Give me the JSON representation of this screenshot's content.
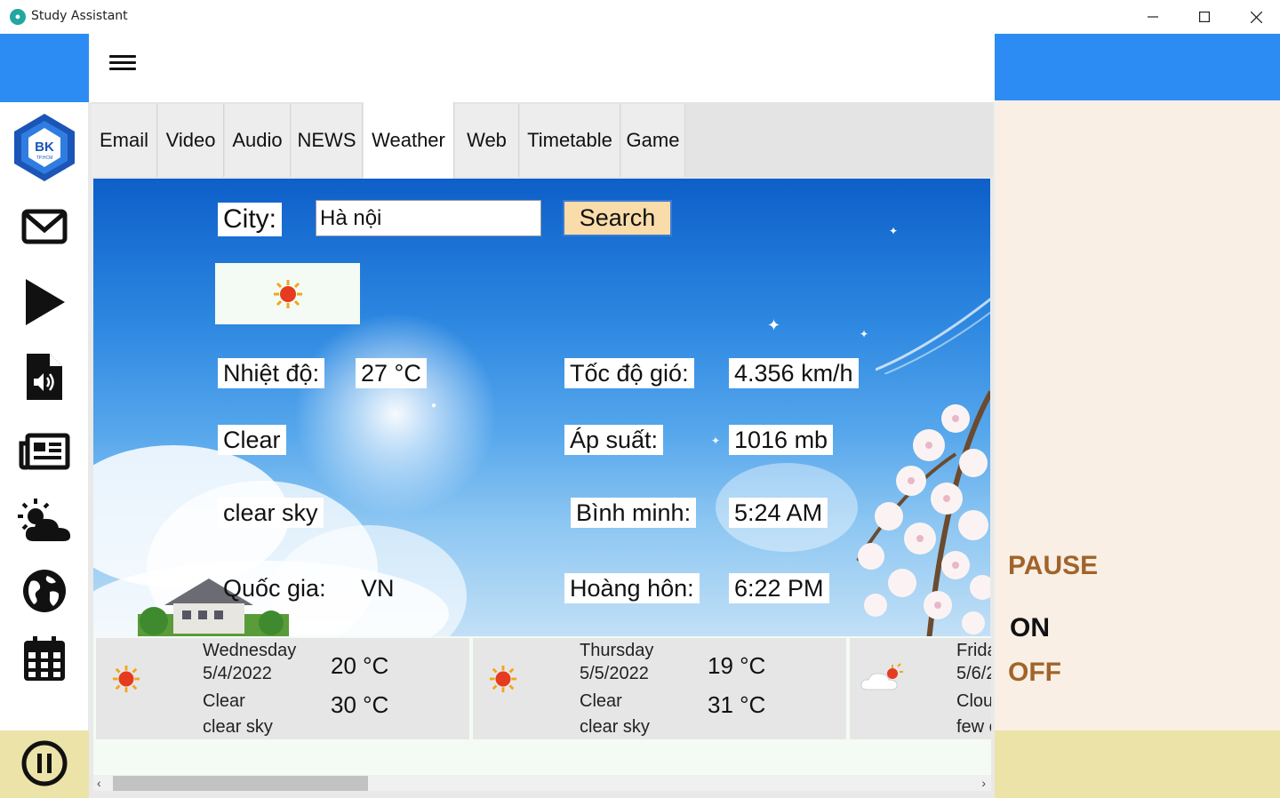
{
  "window": {
    "title": "Study Assistant",
    "minimize_icon": "minimize-icon",
    "maximize_icon": "maximize-icon",
    "close_icon": "close-icon"
  },
  "header": {
    "menu_icon": "hamburger-icon",
    "accent_color": "#2d8cf4"
  },
  "sidebar": {
    "logo": {
      "text": "BK",
      "subtext": "TP.HCM"
    },
    "items": [
      {
        "icon": "mail-icon"
      },
      {
        "icon": "play-icon"
      },
      {
        "icon": "audio-file-icon"
      },
      {
        "icon": "newspaper-icon"
      },
      {
        "icon": "weather-icon"
      },
      {
        "icon": "globe-icon"
      },
      {
        "icon": "calendar-icon"
      }
    ],
    "pause_icon": "pause-circle-icon"
  },
  "tabs": [
    {
      "label": "Email",
      "active": false
    },
    {
      "label": "Video",
      "active": false
    },
    {
      "label": "Audio",
      "active": false
    },
    {
      "label": "NEWS",
      "active": false
    },
    {
      "label": "Weather",
      "active": true
    },
    {
      "label": "Web",
      "active": false
    },
    {
      "label": "Timetable",
      "active": false
    },
    {
      "label": "Game",
      "active": false
    }
  ],
  "weather": {
    "city_label": "City:",
    "city_value": "Hà nội",
    "search_label": "Search",
    "current_icon": "sun-icon",
    "temp_label": "Nhiệt độ:",
    "temp_value": "27 °C",
    "main": "Clear",
    "description": "clear sky",
    "country_label": "Quốc gia:",
    "country_value": "VN",
    "wind_label": "Tốc độ gió:",
    "wind_value": "4.356 km/h",
    "pressure_label": "Áp suất:",
    "pressure_value": "1016 mb",
    "sunrise_label": "Bình minh:",
    "sunrise_value": "5:24 AM",
    "sunset_label": "Hoàng hôn:",
    "sunset_value": "6:22 PM"
  },
  "forecast": [
    {
      "icon": "sun-icon",
      "day": "Wednesday",
      "date": "5/4/2022",
      "main": "Clear",
      "desc": "clear sky",
      "min": "20 °C",
      "max": "30 °C"
    },
    {
      "icon": "sun-icon",
      "day": "Thursday",
      "date": "5/5/2022",
      "main": "Clear",
      "desc": "clear sky",
      "min": "19 °C",
      "max": "31 °C"
    },
    {
      "icon": "cloud-sun-icon",
      "day": "Frida",
      "date": "5/6/2",
      "main": "Clou",
      "desc": "few c",
      "min": "",
      "max": ""
    }
  ],
  "right_panel": {
    "pause_label": "PAUSE",
    "on_label": "ON",
    "off_label": "OFF"
  },
  "scroll": {
    "left_arrow": "‹",
    "right_arrow": "›"
  }
}
